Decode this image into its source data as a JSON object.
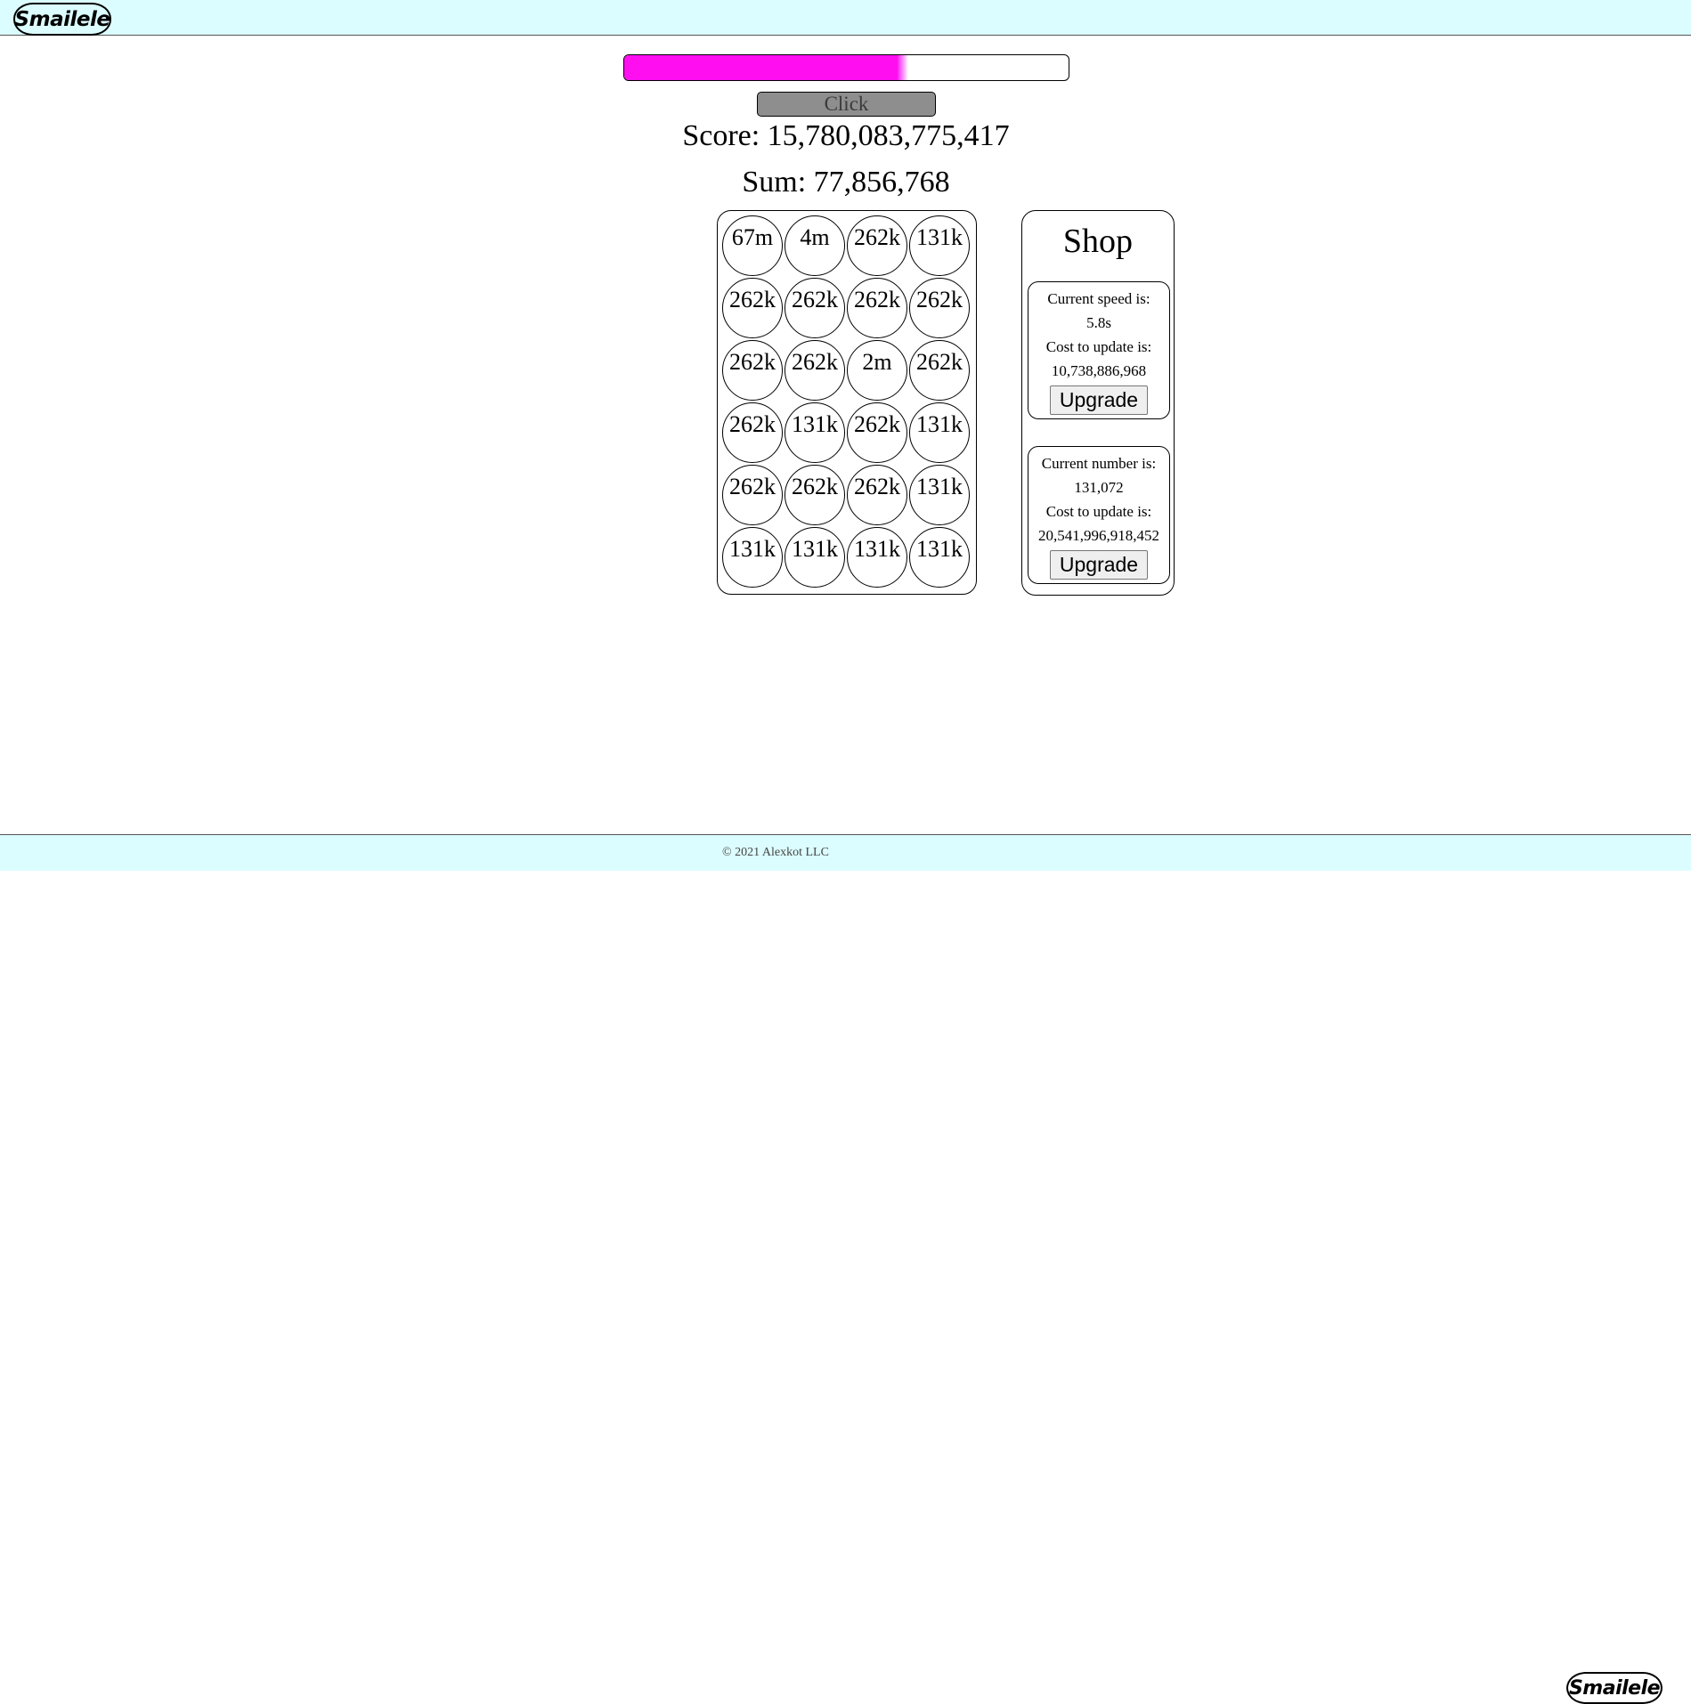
{
  "header": {
    "logo_text": "Smailele"
  },
  "progress": {
    "fraction": 0.64
  },
  "click_button": {
    "label": "Click"
  },
  "score": {
    "label": "Score:",
    "value": "15,780,083,775,417"
  },
  "sum": {
    "label": "Sum:",
    "value": "77,856,768"
  },
  "grid": {
    "cells": [
      "67m",
      "4m",
      "262k",
      "131k",
      "262k",
      "262k",
      "262k",
      "262k",
      "262k",
      "262k",
      "2m",
      "262k",
      "262k",
      "131k",
      "262k",
      "131k",
      "262k",
      "262k",
      "262k",
      "131k",
      "131k",
      "131k",
      "131k",
      "131k"
    ]
  },
  "shop": {
    "title": "Shop",
    "speed": {
      "label": "Current speed is:",
      "value": "5.8s",
      "cost_label": "Cost to update is:",
      "cost": "10,738,886,968",
      "button": "Upgrade"
    },
    "number": {
      "label": "Current number is:",
      "value": "131,072",
      "cost_label": "Cost to update is:",
      "cost": "20,541,996,918,452",
      "button": "Upgrade"
    }
  },
  "footer": {
    "copyright": "© 2021 Alexkot LLC",
    "logo_text": "Smailele"
  },
  "colors": {
    "bar_fill": "#ff0ff0",
    "header_bg": "#dcfdff",
    "click_button_bg": "#8e8e8e"
  }
}
